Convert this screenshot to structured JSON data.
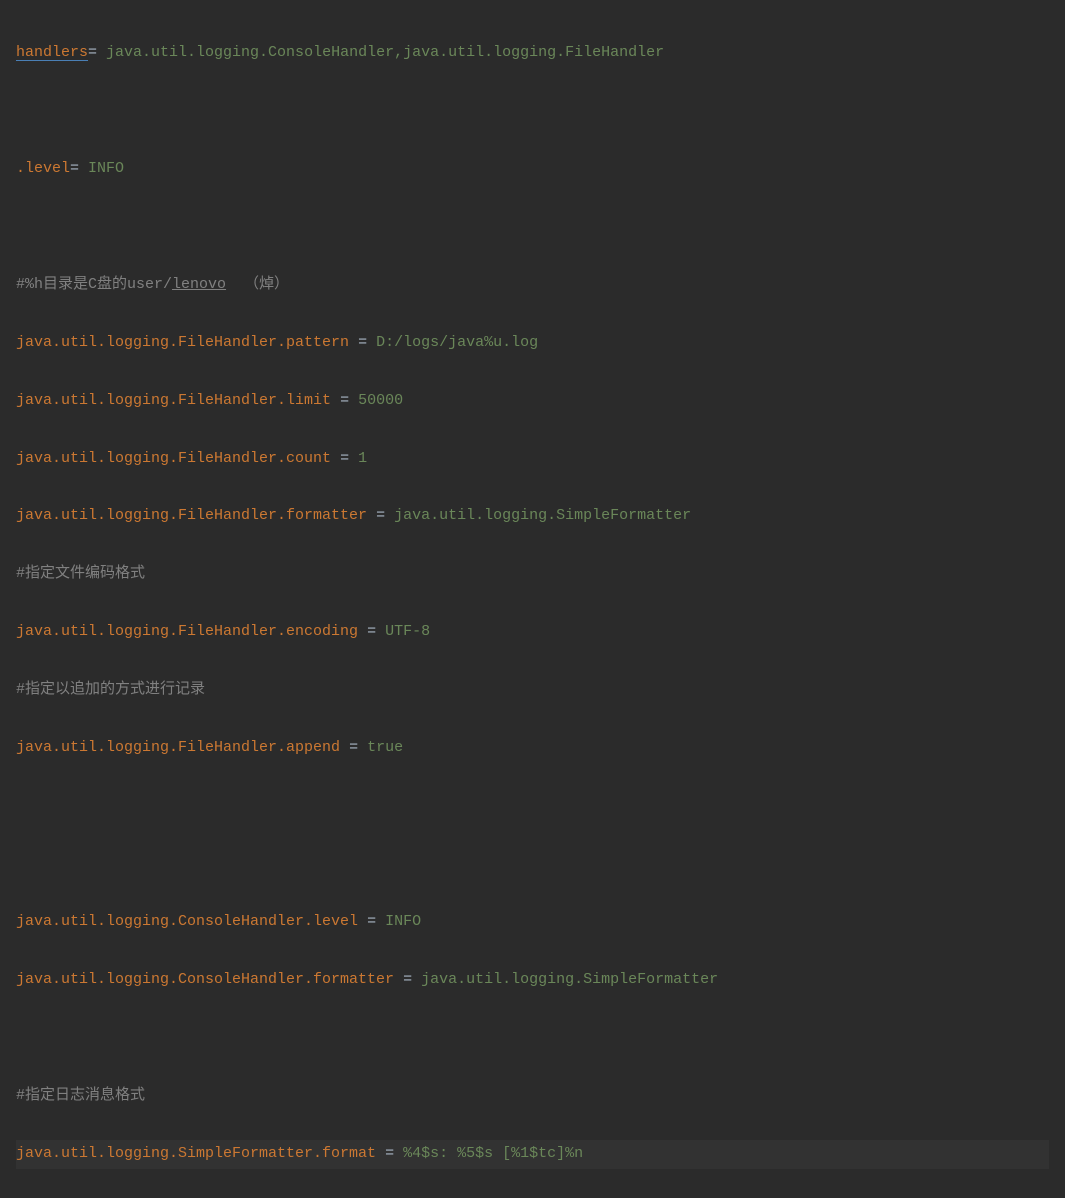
{
  "lines": {
    "l1_key": "handlers",
    "l1_op": "= ",
    "l1_value": "java.util.logging.ConsoleHandler,java.util.logging.FileHandler",
    "l3_key": ".level",
    "l3_op": "= ",
    "l3_value": "INFO",
    "l5_comment_a": "#%h目录是C盘的user/",
    "l5_comment_b": "lenovo",
    "l5_comment_c": "  （焯）",
    "l6_key": "java.util.logging.FileHandler.pattern",
    "l6_op": " = ",
    "l6_value": "D:/logs/java%u.log",
    "l7_key": "java.util.logging.FileHandler.limit",
    "l7_op": " = ",
    "l7_value": "50000",
    "l8_key": "java.util.logging.FileHandler.count",
    "l8_op": " = ",
    "l8_value": "1",
    "l9_key": "java.util.logging.FileHandler.formatter",
    "l9_op": " = ",
    "l9_value": "java.util.logging.SimpleFormatter",
    "l10_comment": "#指定文件编码格式",
    "l11_key": "java.util.logging.FileHandler.encoding",
    "l11_op": " = ",
    "l11_value": "UTF-8",
    "l12_comment": "#指定以追加的方式进行记录",
    "l13_key": "java.util.logging.FileHandler.append",
    "l13_op": " = ",
    "l13_value": "true",
    "l16_key": "java.util.logging.ConsoleHandler.level",
    "l16_op": " = ",
    "l16_value": "INFO",
    "l17_key": "java.util.logging.ConsoleHandler.formatter",
    "l17_op": " = ",
    "l17_value": "java.util.logging.SimpleFormatter",
    "l19_comment": "#指定日志消息格式",
    "l20_key": "java.util.logging.SimpleFormatter.format",
    "l20_op": " = ",
    "l20_value": "%4$s: %5$s [%1$tc]%n"
  }
}
